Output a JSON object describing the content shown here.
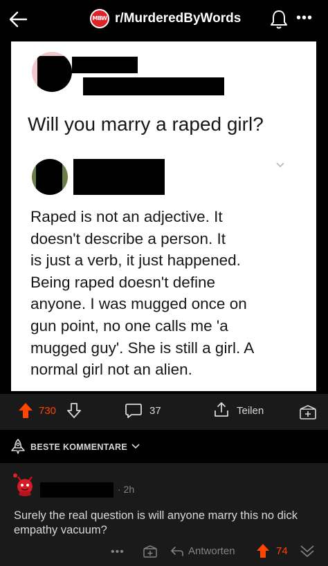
{
  "header": {
    "subreddit_badge": "MBW",
    "subreddit_name": "r/MurderedByWords",
    "more_glyph": "•••"
  },
  "post": {
    "question": "Will you marry a raped girl?",
    "reply_lines": [
      "Raped is not an adjective. It",
      "doesn't describe a person. It",
      "is just a verb, it just happened.",
      "Being raped doesn't define",
      "anyone. I was mugged once on",
      "gun point, no one calls me 'a",
      "mugged guy'. She is still a girl. A",
      "normal girl not an alien."
    ]
  },
  "actions": {
    "score": "730",
    "comments": "37",
    "share_label": "Teilen"
  },
  "sort": {
    "label": "BESTE KOMMENTARE"
  },
  "comment": {
    "time": "· 2h",
    "body": "Surely the real question is will anyone marry this no dick empathy vacuum?",
    "more_glyph": "•••",
    "reply_label": "Antworten",
    "score": "74"
  },
  "colors": {
    "accent": "#ff4500",
    "background": "#000000",
    "surface": "#1a1a1b",
    "text": "#d7dadc",
    "muted": "#818384"
  }
}
